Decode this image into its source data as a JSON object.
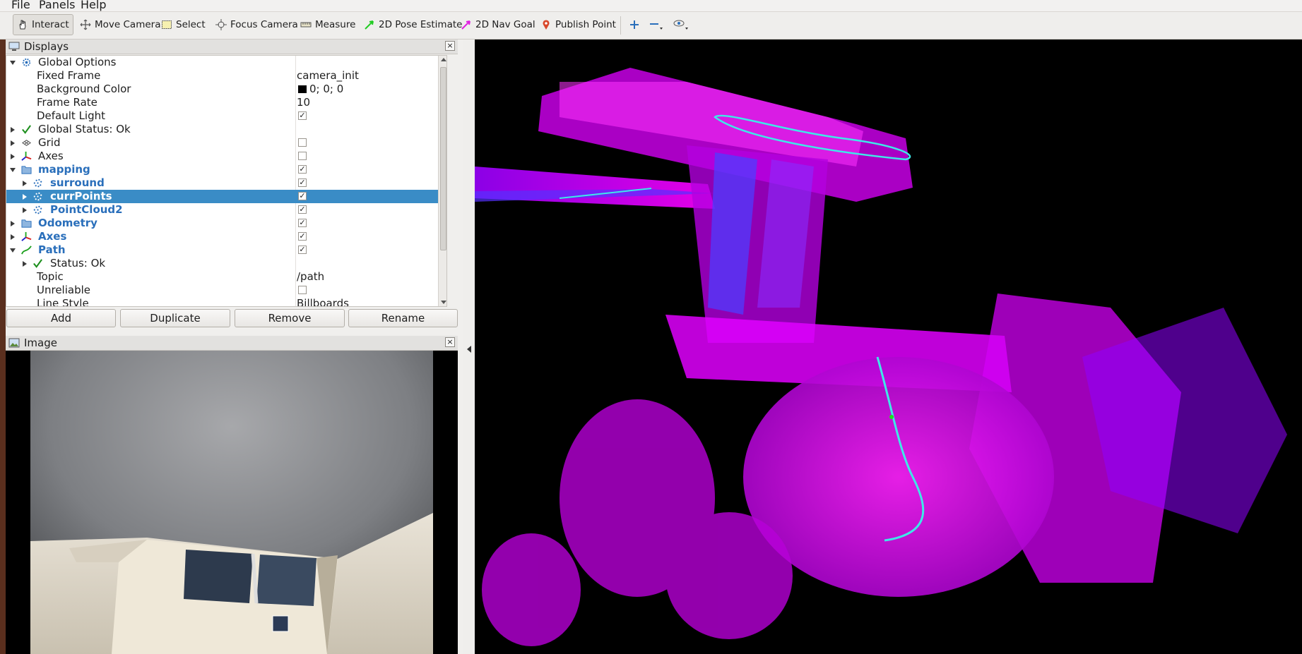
{
  "menu": {
    "file": "File",
    "panels": "Panels",
    "help": "Help"
  },
  "toolbar": {
    "interact": "Interact",
    "move_camera": "Move Camera",
    "select": "Select",
    "focus_camera": "Focus Camera",
    "measure": "Measure",
    "pose_estimate": "2D Pose Estimate",
    "nav_goal": "2D Nav Goal",
    "publish_point": "Publish Point"
  },
  "displays": {
    "title": "Displays",
    "rows": [
      {
        "name": "Global Options",
        "value": ""
      },
      {
        "name": "Fixed Frame",
        "value": "camera_init"
      },
      {
        "name": "Background Color",
        "value": "0; 0; 0"
      },
      {
        "name": "Frame Rate",
        "value": "10"
      },
      {
        "name": "Default Light",
        "value": ""
      },
      {
        "name": "Global Status: Ok",
        "value": ""
      },
      {
        "name": "Grid",
        "value": ""
      },
      {
        "name": "Axes",
        "value": ""
      },
      {
        "name": "mapping",
        "value": ""
      },
      {
        "name": "surround",
        "value": ""
      },
      {
        "name": "currPoints",
        "value": ""
      },
      {
        "name": "PointCloud2",
        "value": ""
      },
      {
        "name": "Odometry",
        "value": ""
      },
      {
        "name": "Axes",
        "value": ""
      },
      {
        "name": "Path",
        "value": ""
      },
      {
        "name": "Status: Ok",
        "value": ""
      },
      {
        "name": "Topic",
        "value": "/path"
      },
      {
        "name": "Unreliable",
        "value": ""
      },
      {
        "name": "Line Style",
        "value": "Billboards"
      }
    ],
    "buttons": {
      "add": "Add",
      "duplicate": "Duplicate",
      "remove": "Remove",
      "rename": "Rename"
    }
  },
  "image_panel": {
    "title": "Image"
  },
  "colors": {
    "selection": "#3a8cc6",
    "point_cloud": "#e600ff",
    "path": "#3ee8e8",
    "background_color_swatch": "#000000"
  }
}
